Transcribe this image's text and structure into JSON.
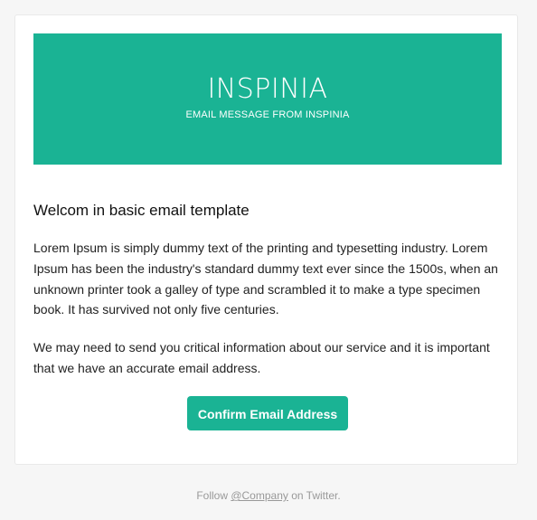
{
  "banner": {
    "brand": "INSPINIA",
    "subtitle": "EMAIL MESSAGE FROM INSPINIA",
    "color": "#1ab394"
  },
  "content": {
    "title": "Welcom in basic email template",
    "paragraph1": "Lorem Ipsum is simply dummy text of the printing and typesetting industry. Lorem Ipsum has been the industry's standard dummy text ever since the 1500s, when an unknown printer took a galley of type and scrambled it to make a type specimen book. It has survived not only five centuries.",
    "paragraph2": "We may need to send you critical information about our service and it is important that we have an accurate email address.",
    "button_label": "Confirm Email Address"
  },
  "footer": {
    "prefix": "Follow ",
    "link": "@Company",
    "suffix": " on Twitter."
  }
}
